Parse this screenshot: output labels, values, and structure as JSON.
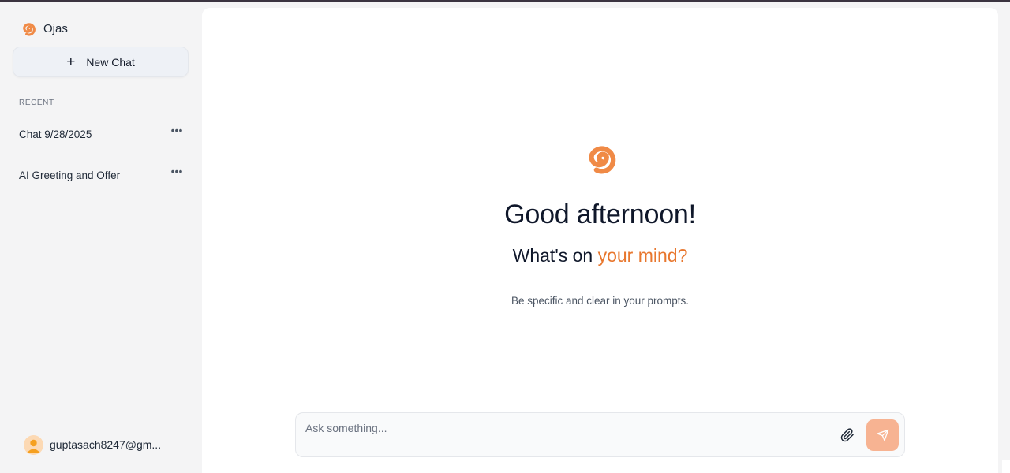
{
  "app": {
    "name": "Ojas",
    "brand_color": "#e8772e"
  },
  "sidebar": {
    "new_chat_label": "New Chat",
    "recent_heading": "RECENT",
    "chats": [
      {
        "title": "Chat 9/28/2025",
        "menu_icon": "more-horizontal-icon"
      },
      {
        "title": "AI Greeting and Offer",
        "menu_icon": "more-horizontal-icon"
      }
    ],
    "user": {
      "email": "guptasach8247@gm...",
      "avatar_icon": "user-avatar-icon"
    }
  },
  "main": {
    "greeting": "Good afternoon!",
    "subtitle_prefix": "What's on ",
    "subtitle_accent": "your mind?",
    "hint": "Be specific and clear in your prompts."
  },
  "composer": {
    "placeholder": "Ask something...",
    "value": "",
    "attach_icon": "paperclip-icon",
    "send_icon": "send-icon"
  },
  "colors": {
    "accent": "#e8772e",
    "send_button": "#f7b392",
    "sidebar_bg": "#f4f4f5",
    "main_bg": "#ffffff"
  }
}
